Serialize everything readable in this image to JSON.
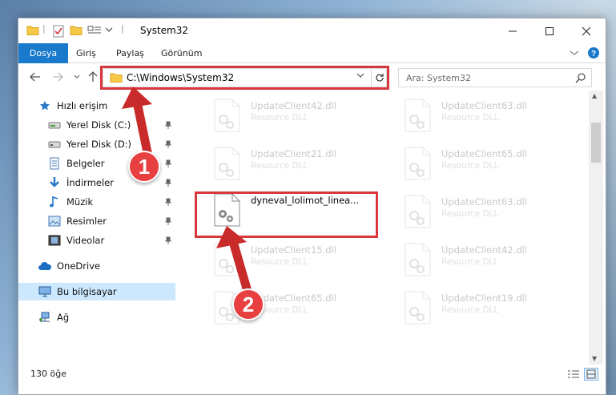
{
  "window": {
    "title": "System32"
  },
  "ribbon": {
    "tabs": [
      "Dosya",
      "Giriş",
      "Paylaş",
      "Görünüm"
    ]
  },
  "address": {
    "path": "C:\\Windows\\System32"
  },
  "search": {
    "placeholder": "Ara: System32"
  },
  "sidebar": {
    "items": [
      {
        "label": "Hızlı erişim",
        "icon": "star-icon",
        "pinned": false
      },
      {
        "label": "Yerel Disk (C:)",
        "icon": "drive-icon",
        "pinned": true
      },
      {
        "label": "Yerel Disk (D:)",
        "icon": "drive-icon",
        "pinned": true
      },
      {
        "label": "Belgeler",
        "icon": "documents-icon",
        "pinned": true
      },
      {
        "label": "İndirmeler",
        "icon": "download-icon",
        "pinned": true
      },
      {
        "label": "Müzik",
        "icon": "music-icon",
        "pinned": true
      },
      {
        "label": "Resimler",
        "icon": "pictures-icon",
        "pinned": true
      },
      {
        "label": "Videolar",
        "icon": "videos-icon",
        "pinned": true
      },
      {
        "label": "OneDrive",
        "icon": "cloud-icon",
        "pinned": false
      },
      {
        "label": "Bu bilgisayar",
        "icon": "computer-icon",
        "pinned": false,
        "selected": true
      },
      {
        "label": "Ağ",
        "icon": "network-icon",
        "pinned": false
      }
    ]
  },
  "files": [
    {
      "name": "UpdateClient42.dll",
      "desc": "Resource DLL",
      "faded": true
    },
    {
      "name": "UpdateClient63.dll",
      "desc": "Resource DLL",
      "faded": true
    },
    {
      "name": "UpdateClient21.dll",
      "desc": "Resource DLL",
      "faded": true
    },
    {
      "name": "UpdateClient65.dll",
      "desc": "Resource DLL",
      "faded": true
    },
    {
      "name": "dyneval_lolimot_linea...",
      "desc": "",
      "faded": false
    },
    {
      "name": "UpdateClient63.dll",
      "desc": "Resource DLL",
      "faded": true
    },
    {
      "name": "UpdateClient15.dll",
      "desc": "Resource DLL",
      "faded": true
    },
    {
      "name": "UpdateClient42.dll",
      "desc": "Resource DLL",
      "faded": true
    },
    {
      "name": "UpdateClient65.dll",
      "desc": "Resource DLL",
      "faded": true
    },
    {
      "name": "UpdateClient19.dll",
      "desc": "Resource DLL",
      "faded": true
    }
  ],
  "status": {
    "item_count": "130 öğe"
  },
  "markers": {
    "one": "1",
    "two": "2"
  },
  "colors": {
    "accent": "#1979ca",
    "highlight": "#d9363e",
    "selected": "#cce8ff"
  }
}
